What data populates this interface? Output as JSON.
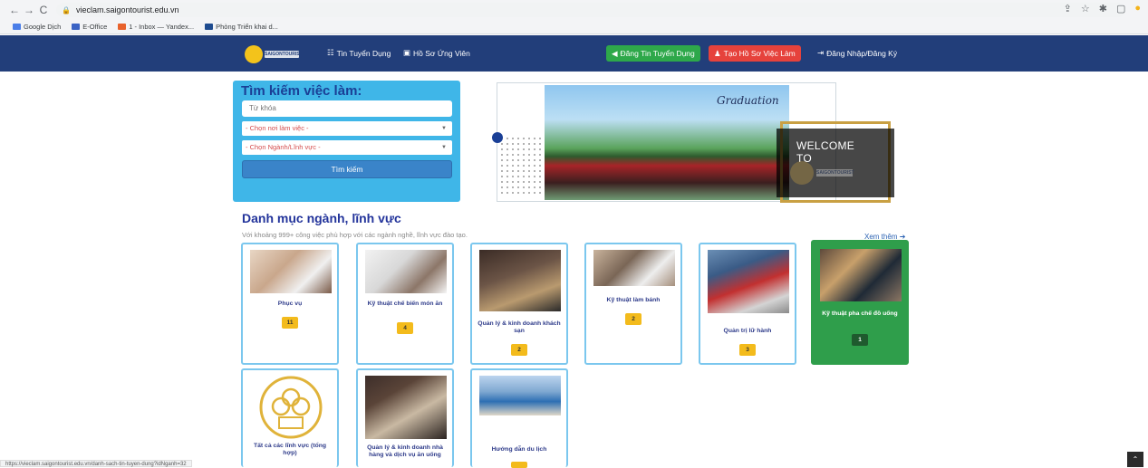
{
  "browser": {
    "url": "vieclam.saigontourist.edu.vn",
    "bookmarks": [
      "Google Dịch",
      "E-Office",
      "1 - Inbox — Yandex...",
      "Phòng Triển khai d..."
    ],
    "status_url": "https://vieclam.saigontourist.edu.vn/danh-sach-tin-tuyen-dung?idNganh=32"
  },
  "nav": {
    "jobs": "Tin Tuyển Dụng",
    "profiles": "Hồ Sơ Ứng Viên",
    "post_job": "Đăng Tin Tuyển Dụng",
    "create_profile": "Tạo Hồ Sơ Việc Làm",
    "login": "Đăng Nhập/Đăng Ký",
    "post_job_color": "#2ea84a",
    "create_profile_color": "#e6423c"
  },
  "search": {
    "title": "Tìm kiếm việc làm:",
    "keyword_placeholder": "Từ khóa",
    "location": "- Chọn nơi làm việc -",
    "industry": "- Chọn Ngành/Lĩnh vực -",
    "button": "Tìm kiếm"
  },
  "banner": {
    "graduation": "Graduation",
    "welcome": "WELCOME TO"
  },
  "categories": {
    "title": "Danh mục ngành, lĩnh vực",
    "subtitle": "Với khoảng 999+ công việc phù hợp với các ngành nghề, lĩnh vực đào tạo.",
    "see_more": "Xem thêm",
    "items": [
      {
        "label": "Phục vụ",
        "count": "11"
      },
      {
        "label": "Kỹ thuật chế biến món ăn",
        "count": "4"
      },
      {
        "label": "Quản lý & kinh doanh khách sạn",
        "count": "2"
      },
      {
        "label": "Kỹ thuật làm bánh",
        "count": "2"
      },
      {
        "label": "Quản trị lữ hành",
        "count": "3"
      },
      {
        "label": "Kỹ thuật pha chế đồ uống",
        "count": "1"
      },
      {
        "label": "Tất cả các lĩnh vực (tổng hợp)"
      },
      {
        "label": "Quản lý & kinh doanh nhà hàng và dịch vụ ăn uống"
      },
      {
        "label": "Hướng dẫn du lịch"
      }
    ]
  }
}
